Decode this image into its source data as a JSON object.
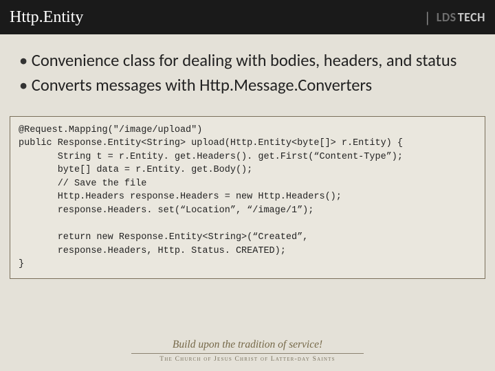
{
  "header": {
    "title": "Http.Entity",
    "logo_divider": "|",
    "logo_lds": "LDS",
    "logo_tech": "TECH"
  },
  "bullets": [
    "Convenience class for dealing with bodies, headers, and status",
    "Converts messages with Http.Message.Converters"
  ],
  "code": "@Request.Mapping(\"/image/upload\")\npublic Response.Entity<String> upload(Http.Entity<byte[]> r.Entity) {\n       String t = r.Entity. get.Headers(). get.First(“Content-Type”);\n       byte[] data = r.Entity. get.Body();\n       // Save the file\n       Http.Headers response.Headers = new Http.Headers();\n       response.Headers. set(“Location”, “/image/1”);\n\n       return new Response.Entity<String>(“Created”,\n       response.Headers, Http. Status. CREATED);\n}",
  "footer": {
    "tagline": "Build upon the tradition of service!",
    "org": "The Church of Jesus Christ of Latter-day Saints"
  }
}
